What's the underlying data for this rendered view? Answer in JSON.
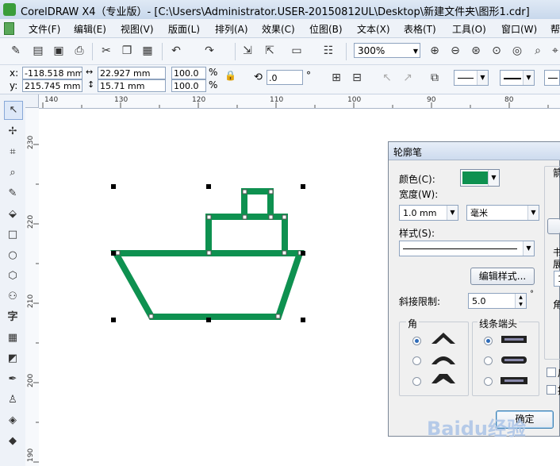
{
  "titlebar": {
    "app_name": "CorelDRAW X4（专业版）- [C:\\Users\\Administrator.USER-20150812UL\\Desktop\\新建文件夹\\图形1.cdr]"
  },
  "menu": [
    "文件(F)",
    "编辑(E)",
    "视图(V)",
    "版面(L)",
    "排列(A)",
    "效果(C)",
    "位图(B)",
    "文本(X)",
    "表格(T)",
    "工具(O)",
    "窗口(W)",
    "帮"
  ],
  "toolbar": {
    "zoom": "300%"
  },
  "property_bar": {
    "x_label": "x:",
    "x_value": "-118.518 mm",
    "y_label": "y:",
    "y_value": "215.745 mm",
    "width_value": "22.927 mm",
    "height_value": "15.71 mm",
    "scale_x": "100.0",
    "scale_y": "100.0",
    "percent": "%",
    "rotation": ".0",
    "degree": "°"
  },
  "ruler_h": [
    "140",
    "130",
    "120",
    "110",
    "100",
    "90",
    "80"
  ],
  "ruler_v": [
    "230",
    "220",
    "210",
    "200",
    "190"
  ],
  "shape": {
    "outline_color": "#0e9150",
    "handle_color": "#000000"
  },
  "dialog": {
    "title": "轮廓笔",
    "color_label": "颜色(C):",
    "color_value": "#0e9150",
    "width_label": "宽度(W):",
    "width_value": "1.0 mm",
    "unit_value": "毫米",
    "style_label": "样式(S):",
    "edit_style_button": "编辑样式...",
    "miter_label": "斜接限制:",
    "miter_value": "5.0",
    "corners_label": "角",
    "caps_label": "线条端头",
    "ok_button": "确定",
    "right_cut_1": "箭",
    "right_cut_2": "书",
    "right_cut_3": "展",
    "right_cut_4": "1",
    "right_cut_5": "角",
    "right_cut_6": "后",
    "right_cut_7": "按"
  },
  "watermark": {
    "text": "Baidu经验"
  }
}
